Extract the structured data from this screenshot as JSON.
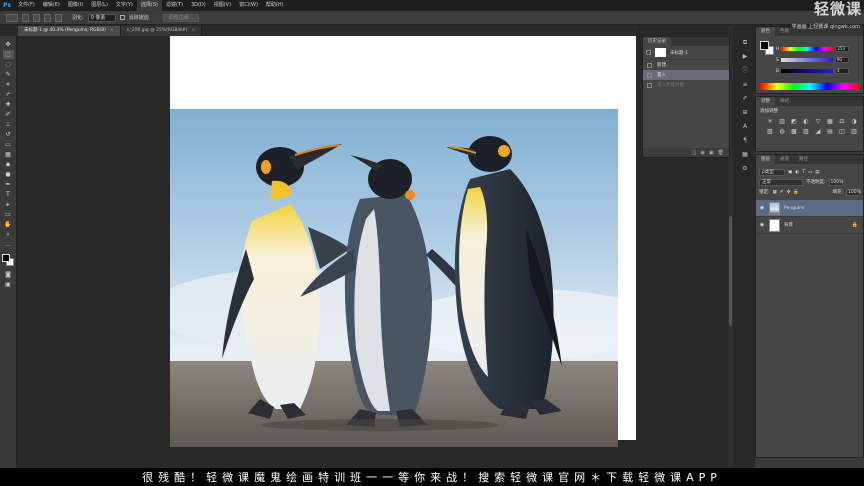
{
  "app": {
    "logo": "Ps",
    "menu": [
      "文件(F)",
      "编辑(E)",
      "图像(I)",
      "图层(L)",
      "文字(Y)",
      "选择(S)",
      "滤镜(T)",
      "3D(D)",
      "视图(V)",
      "窗口(W)",
      "帮助(H)"
    ],
    "active_menu_index": 5
  },
  "options_bar": {
    "feather_label": "羽化:",
    "feather_value": "0 像素",
    "antialias_label": "消除锯齿",
    "refine_edge_label": "调整边缘..."
  },
  "tabs": [
    {
      "label": "未标题-1 @ 40.3% (Penguins, RGB/8)",
      "close": "×",
      "active": true
    },
    {
      "label": "n_206.jpg @ 25%(RGB/8#)",
      "close": "×",
      "active": false
    }
  ],
  "history_panel": {
    "tab_history": "历史记录",
    "snapshot_label": "未标题-1",
    "items": [
      {
        "label": "新建",
        "state": "normal"
      },
      {
        "label": "置入",
        "state": "selected"
      },
      {
        "label": "置入智能对象",
        "state": "ghost"
      }
    ],
    "footer_icons": [
      "◫",
      "◉",
      "▣",
      "🗑"
    ]
  },
  "color_panel": {
    "tab_color": "颜色",
    "tab_swatches": "色板",
    "channels": [
      {
        "label": "H",
        "value": "253",
        "gradient": "linear-gradient(to right,#f00,#ff0,#0f0,#0ff,#00f,#f0f,#f00)"
      },
      {
        "label": "S",
        "value": "90",
        "gradient": "linear-gradient(to right,#ddd,#2a1bd8)"
      },
      {
        "label": "B",
        "value": "4",
        "gradient": "linear-gradient(to right,#000,#2a1bd8)"
      }
    ]
  },
  "adjustments_panel": {
    "tab_adjust": "调整",
    "tab_styles": "样式",
    "title": "添加调整",
    "icons": [
      "☀",
      "▥",
      "◩",
      "◐",
      "▽",
      "",
      "",
      "",
      "▦",
      "⚖",
      "◑",
      "▨",
      "◍",
      "▩",
      "",
      "",
      "▧",
      "◢",
      "▤",
      "◫",
      "▥",
      "",
      "",
      ""
    ]
  },
  "layers_panel": {
    "tab_layers": "图层",
    "tab_channels": "通道",
    "tab_paths": "路径",
    "kind_label": "ρ类型",
    "blend_mode": "正常",
    "opacity_label": "不透明度:",
    "opacity_value": "100%",
    "lock_label": "锁定:",
    "fill_label": "填充:",
    "fill_value": "100%",
    "layers": [
      {
        "name": "Penguins",
        "selected": true,
        "thumb": "img",
        "lock": ""
      },
      {
        "name": "背景",
        "selected": false,
        "thumb": "bg",
        "lock": "🔒"
      }
    ]
  },
  "watermark": {
    "brand": "轻微课",
    "sub": "学画画 上轻微课 qingwk.com"
  },
  "subtitle": "很残酷！轻微课魔鬼绘画特训班一一等你来战！搜索轻微课官网＊下载轻微课APP"
}
